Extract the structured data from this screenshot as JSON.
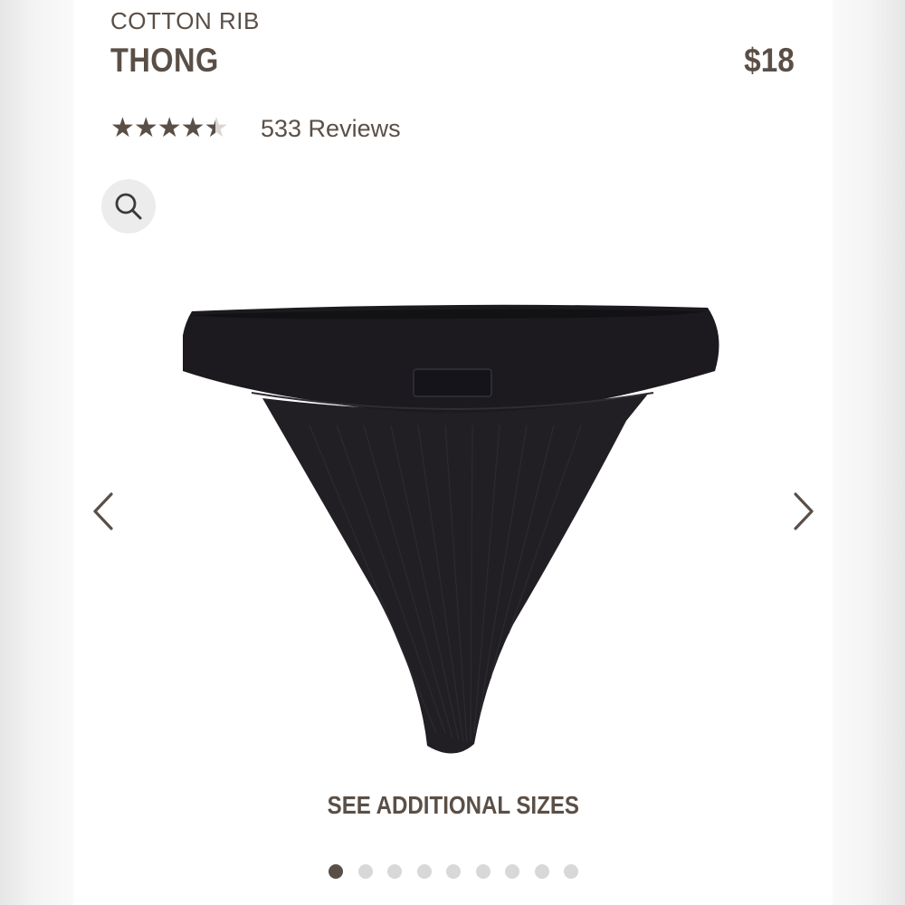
{
  "product": {
    "subtitle": "COTTON RIB",
    "name": "THONG",
    "price": "$18",
    "rating": 4.5,
    "rating_max": 5,
    "reviews_label": "533 Reviews"
  },
  "gallery": {
    "see_sizes_label": "SEE ADDITIONAL SIZES",
    "dot_count": 9,
    "active_index": 0,
    "product_color": "#232126"
  },
  "icons": {
    "zoom": "search-icon",
    "prev": "chevron-left-icon",
    "next": "chevron-right-icon",
    "star": "★"
  },
  "colors": {
    "text": "#5a4f47",
    "star_empty": "#d9d6d3",
    "dot_inactive": "#d8d8d8"
  }
}
